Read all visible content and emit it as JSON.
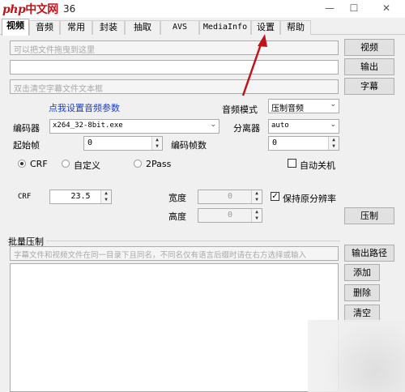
{
  "window": {
    "logo_php": "php",
    "logo_text": "中文网",
    "title_version": "36",
    "controls": {
      "minimize": "—",
      "maximize": "☐",
      "close": "✕"
    }
  },
  "tabs": [
    {
      "label": "视频",
      "active": true
    },
    {
      "label": "音频"
    },
    {
      "label": "常用"
    },
    {
      "label": "封装"
    },
    {
      "label": "抽取"
    },
    {
      "label": "AVS"
    },
    {
      "label": "MediaInfo"
    },
    {
      "label": "设置"
    },
    {
      "label": "帮助"
    }
  ],
  "video_tab": {
    "video_file_placeholder": "可以把文件拖曳到这里",
    "output_field": "",
    "subtitle_placeholder": "双击清空字幕文件文本框",
    "buttons": {
      "video": "视频",
      "output": "输出",
      "subtitle": "字幕",
      "compress": "压制"
    },
    "audio_settings_link": "点我设置音频参数",
    "audio_mode_label": "音频模式",
    "audio_mode_value": "压制音频",
    "encoder_label": "编码器",
    "encoder_value": "x264_32-8bit.exe",
    "demuxer_label": "分离器",
    "demuxer_value": "auto",
    "start_frame_label": "起始帧",
    "start_frame_value": "0",
    "encode_frames_label": "编码帧数",
    "encode_frames_value": "0",
    "rate_modes": [
      "CRF",
      "自定义",
      "2Pass"
    ],
    "rate_mode_selected": "CRF",
    "auto_shutdown_label": "自动关机",
    "crf_label": "CRF",
    "crf_value": "23.5",
    "width_label": "宽度",
    "width_value": "0",
    "height_label": "高度",
    "height_value": "0",
    "keep_ratio_label": "保持原分辨率",
    "keep_ratio_checked": true
  },
  "batch": {
    "title": "批量压制",
    "hint": "字幕文件和视频文件在同一目录下且同名，不同名仅有语言后缀时请在右方选择或输入",
    "buttons": {
      "output_path": "输出路径",
      "add": "添加",
      "delete": "删除",
      "clear": "清空"
    }
  }
}
